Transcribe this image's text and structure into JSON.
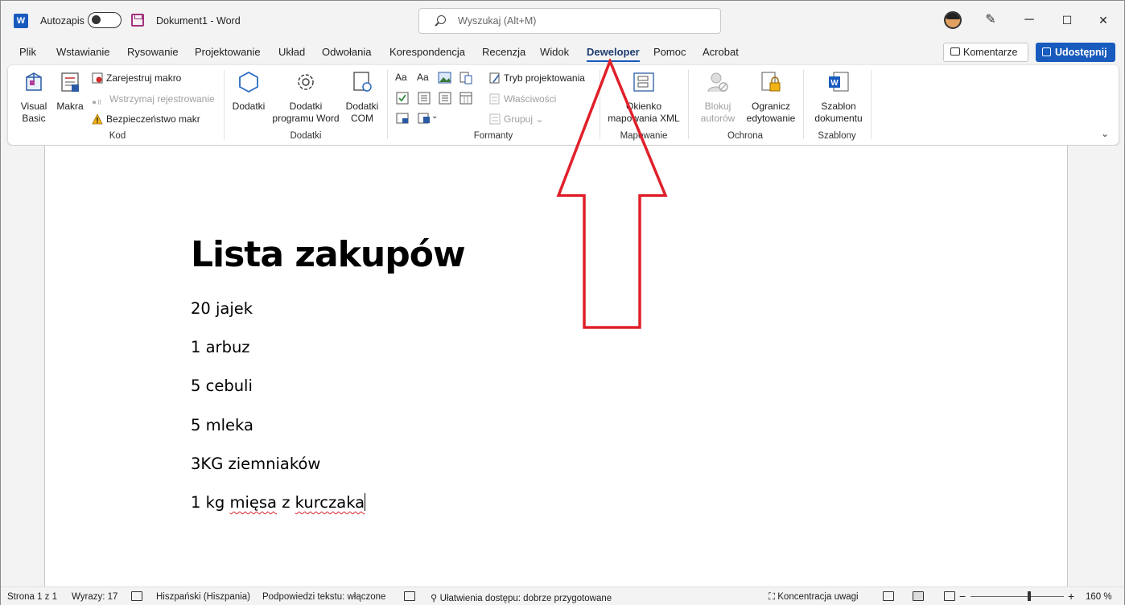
{
  "titlebar": {
    "app_icon": "W",
    "autosave_label": "Autozapis",
    "doc_title": "Dokument1  -  Word",
    "search_placeholder": "Wyszukaj (Alt+M)",
    "minimize": "─",
    "maximize": "☐",
    "close": "✕"
  },
  "tabs": [
    {
      "label": "Plik"
    },
    {
      "label": "Wstawianie"
    },
    {
      "label": "Rysowanie"
    },
    {
      "label": "Projektowanie"
    },
    {
      "label": "Układ"
    },
    {
      "label": "Odwołania"
    },
    {
      "label": "Korespondencja"
    },
    {
      "label": "Recenzja"
    },
    {
      "label": "Widok"
    },
    {
      "label": "Deweloper",
      "active": true
    },
    {
      "label": "Pomoc"
    },
    {
      "label": "Acrobat"
    }
  ],
  "actions": {
    "comments": "Komentarze",
    "share": "Udostępnij"
  },
  "ribbon": {
    "kod": {
      "label": "Kod",
      "visual_basic": "Visual\nBasic",
      "visual_basic_l1": "Visual",
      "visual_basic_l2": "Basic",
      "makra": "Makra",
      "record_macro": "Zarejestruj makro",
      "pause_recording": "Wstrzymaj rejestrowanie",
      "macro_security": "Bezpieczeństwo makr"
    },
    "dodatki": {
      "label": "Dodatki",
      "addins": "Dodatki",
      "word_addins_l1": "Dodatki",
      "word_addins_l2": "programu Word",
      "com_addins_l1": "Dodatki",
      "com_addins_l2": "COM"
    },
    "formanty": {
      "label": "Formanty",
      "design_mode": "Tryb projektowania",
      "properties": "Właściwości",
      "group": "Grupuj"
    },
    "mapowanie": {
      "label": "Mapowanie",
      "xml_pane_l1": "Okienko",
      "xml_pane_l2": "mapowania XML"
    },
    "ochrona": {
      "label": "Ochrona",
      "block_authors_l1": "Blokuj",
      "block_authors_l2": "autorów",
      "restrict_l1": "Ogranicz",
      "restrict_l2": "edytowanie"
    },
    "szablony": {
      "label": "Szablony",
      "template_l1": "Szablon",
      "template_l2": "dokumentu"
    }
  },
  "document": {
    "heading": "Lista zakupów",
    "items": [
      "20 jajek",
      "1 arbuz",
      "5 cebuli",
      "5 mleka",
      "3KG ziemniaków"
    ],
    "last_item_prefix": "1 kg ",
    "last_item_word1": "mięsa",
    "last_item_mid": " z ",
    "last_item_word2": "kurczaka"
  },
  "statusbar": {
    "page": "Strona 1 z 1",
    "words": "Wyrazy: 17",
    "language": "Hiszpański (Hiszpania)",
    "text_predictions": "Podpowiedzi tekstu: włączone",
    "accessibility": "Ułatwienia dostępu: dobrze przygotowane",
    "focus": "Koncentracja uwagi",
    "zoom_minus": "−",
    "zoom_plus": "+",
    "zoom": "160 %"
  },
  "colors": {
    "accent": "#185abd",
    "arrow": "#e0202a"
  }
}
